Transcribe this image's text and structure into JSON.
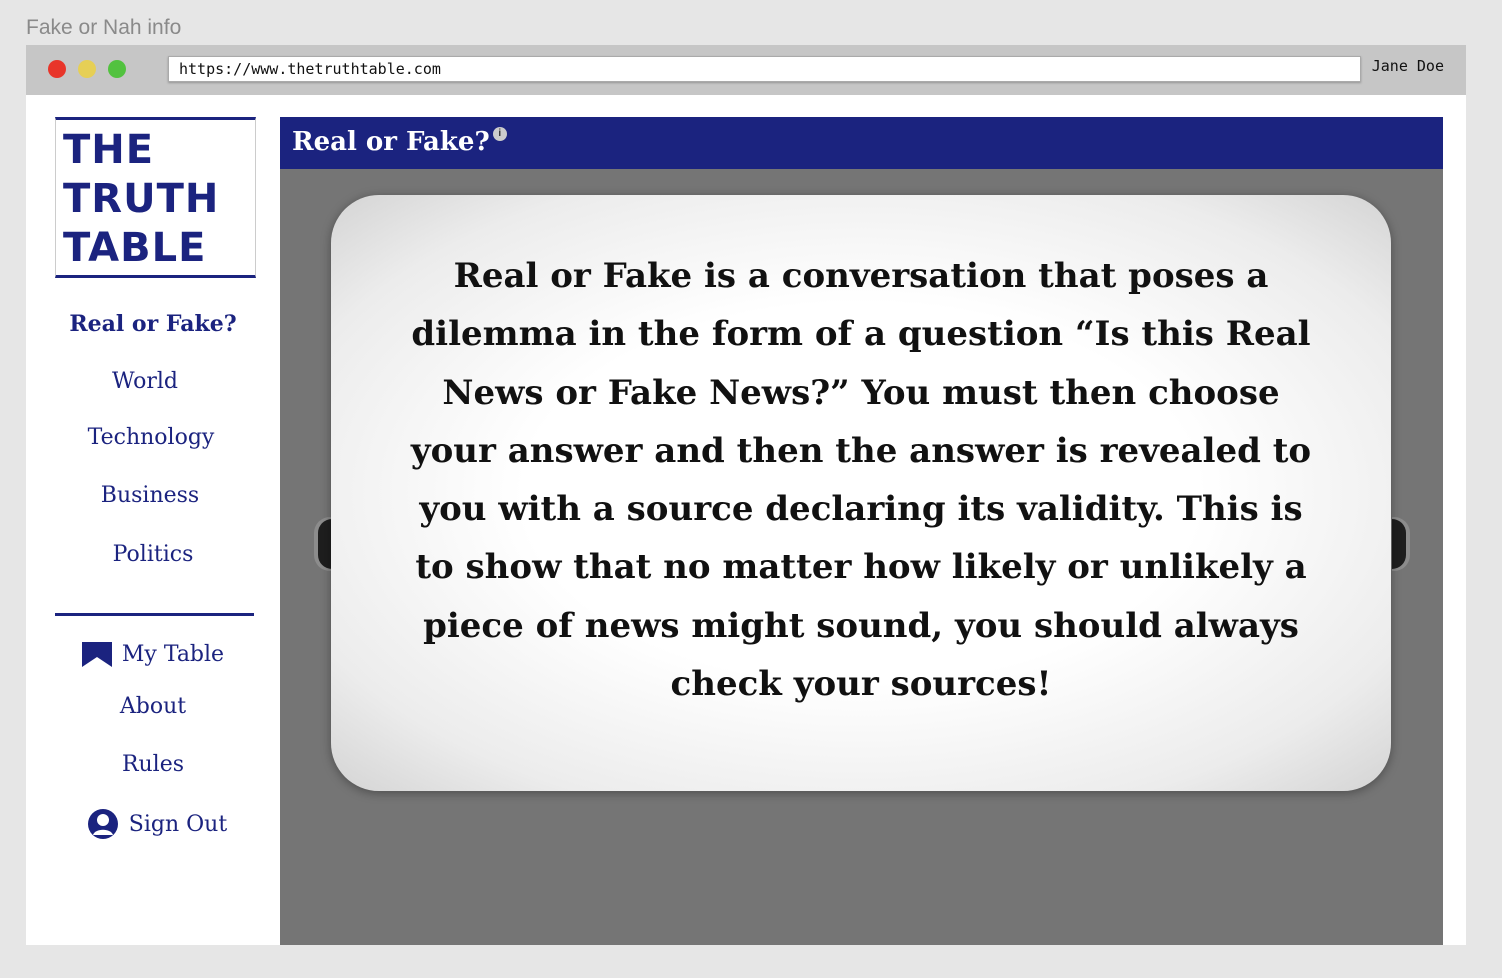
{
  "window": {
    "title": "Fake or Nah info"
  },
  "browser": {
    "url": "https://www.thetruthtable.com",
    "user": "Jane Doe"
  },
  "logo": {
    "lines": [
      "THE",
      "TRUTH",
      "TABLE"
    ]
  },
  "sidebar": {
    "categories": [
      {
        "label": "Real or Fake?",
        "active": true
      },
      {
        "label": "World"
      },
      {
        "label": "Technology"
      },
      {
        "label": "Business"
      },
      {
        "label": "Politics"
      }
    ],
    "account": [
      {
        "label": "My Table",
        "icon": "bookmark-icon"
      },
      {
        "label": "About"
      },
      {
        "label": "Rules"
      },
      {
        "label": "Sign Out",
        "icon": "user-icon"
      }
    ]
  },
  "main": {
    "header": "Real or Fake?",
    "info_icon": "i",
    "card_text": "Real or Fake is a conversation that poses a dilemma in the form of a question “Is this Real News or Fake News?” You must then choose your answer and then the answer is revealed to you with a source declaring its validity.  This is to show that no matter how likely or unlikely a piece of news might sound, you should always check your sources!"
  },
  "colors": {
    "brand": "#1b237f",
    "panel": "#757575"
  }
}
